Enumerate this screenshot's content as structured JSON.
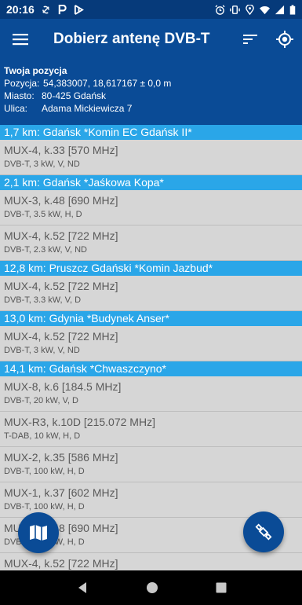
{
  "status_bar": {
    "time": "20:16",
    "left_icons": [
      "sync-icon",
      "p-badge-icon",
      "flag-icon"
    ],
    "right_icons": [
      "alarm-icon",
      "vibrate-icon",
      "location-icon",
      "wifi-icon",
      "signal-icon",
      "battery-icon"
    ]
  },
  "app_bar": {
    "title": "Dobierz antenę DVB-T"
  },
  "position": {
    "heading": "Twoja pozycja",
    "coords_label": "Pozycja:",
    "coords_value": "54,383007, 18,617167 ± 0,0 m",
    "city_label": "Miasto:",
    "city_value": "80-425 Gdańsk",
    "street_label": "Ulica:",
    "street_value": "Adama Mickiewicza 7"
  },
  "sites": [
    {
      "header": "1,7 km: Gdańsk *Komin EC Gdańsk II*",
      "muxes": [
        {
          "name": "MUX-4, k.33 [570 MHz]",
          "params": "DVB-T, 3 kW, V, ND"
        }
      ]
    },
    {
      "header": "2,1 km: Gdańsk *Jaśkowa Kopa*",
      "muxes": [
        {
          "name": "MUX-3, k.48 [690 MHz]",
          "params": "DVB-T, 3.5 kW, H, D"
        },
        {
          "name": "MUX-4, k.52 [722 MHz]",
          "params": "DVB-T, 2.3 kW, V, ND"
        }
      ]
    },
    {
      "header": "12,8 km: Pruszcz Gdański *Komin Jazbud*",
      "muxes": [
        {
          "name": "MUX-4, k.52 [722 MHz]",
          "params": "DVB-T, 3.3 kW, V, D"
        }
      ]
    },
    {
      "header": "13,0 km: Gdynia *Budynek Anser*",
      "muxes": [
        {
          "name": "MUX-4, k.52 [722 MHz]",
          "params": "DVB-T, 3 kW, V, ND"
        }
      ]
    },
    {
      "header": "14,1 km: Gdańsk *Chwaszczyno*",
      "muxes": [
        {
          "name": "MUX-8, k.6 [184.5 MHz]",
          "params": "DVB-T, 20 kW, V, D"
        },
        {
          "name": "MUX-R3, k.10D [215.072 MHz]",
          "params": "T-DAB, 10 kW, H, D"
        },
        {
          "name": "MUX-2, k.35 [586 MHz]",
          "params": "DVB-T, 100 kW, H, D"
        },
        {
          "name": "MUX-1, k.37 [602 MHz]",
          "params": "DVB-T, 100 kW, H, D"
        },
        {
          "name": "MUX-3, k.48 [690 MHz]",
          "params": "DVB-T, 100 kW, H, D"
        },
        {
          "name": "MUX-4, k.52 [722 MHz]",
          "params": ""
        }
      ]
    }
  ],
  "colors": {
    "status_bar": "#063a7a",
    "primary": "#0a4b96",
    "site_header": "#2aa6e8",
    "list_background": "#d6d6d6",
    "nav_bar": "#000000"
  }
}
